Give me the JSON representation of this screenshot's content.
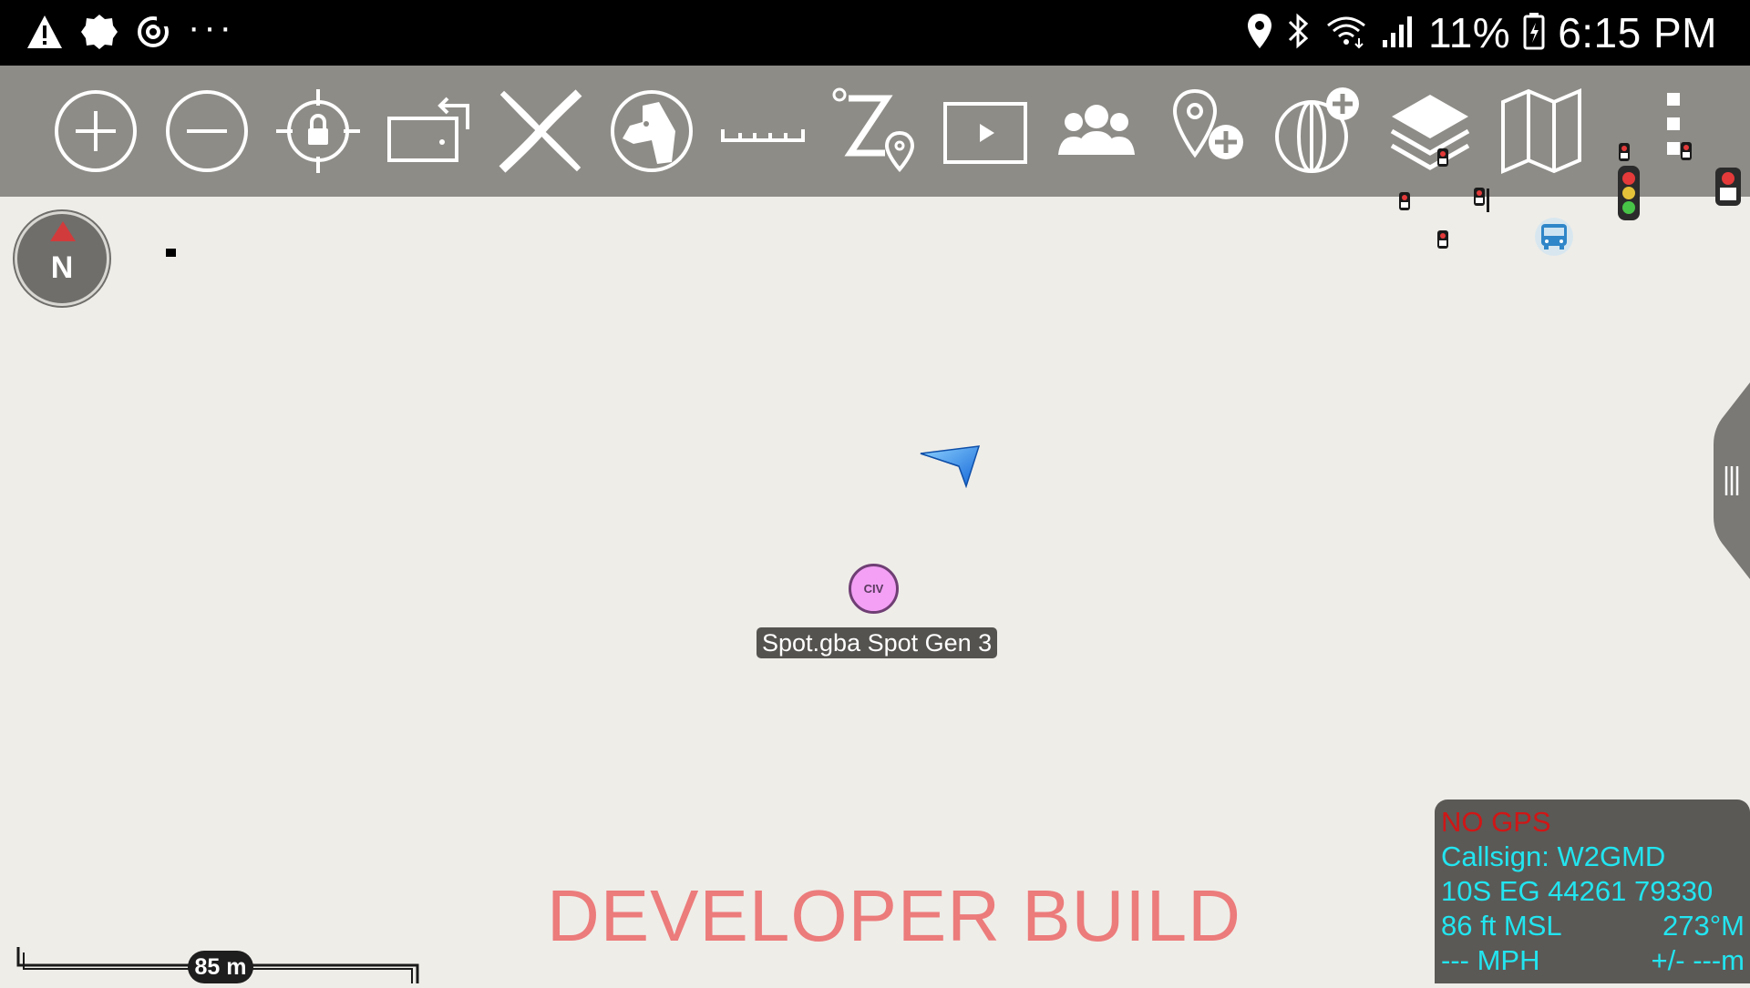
{
  "status_bar": {
    "battery": "11%",
    "time": "6:15 PM",
    "overflow": "···"
  },
  "toolbar": {
    "tools": [
      "zoom-in",
      "zoom-out",
      "lock-location",
      "rotate-screen",
      "close",
      "dog-tool",
      "measure",
      "elevation-route",
      "video",
      "contacts",
      "add-point",
      "add-globe",
      "layers",
      "map",
      "overflow-menu"
    ]
  },
  "compass": {
    "letter": "N"
  },
  "map": {
    "marker": {
      "type_text": "CIV",
      "label": "Spot.gba Spot Gen 3",
      "color": "#f3a0f5"
    }
  },
  "watermark": "DEVELOPER BUILD",
  "scale": {
    "label": "85 m"
  },
  "info_panel": {
    "gps_status": "NO GPS",
    "callsign": "Callsign: W2GMD",
    "grid": "10S  EG  44261  79330",
    "altitude": "86 ft MSL",
    "heading": "273°M",
    "speed": "--- MPH",
    "accuracy": "+/- ---m"
  },
  "colors": {
    "toolbar_bg": "#8e8c87",
    "map_bg": "#efede8",
    "info_text": "#22e5f0",
    "no_gps": "#d01616",
    "watermark": "#ec7b7b"
  }
}
